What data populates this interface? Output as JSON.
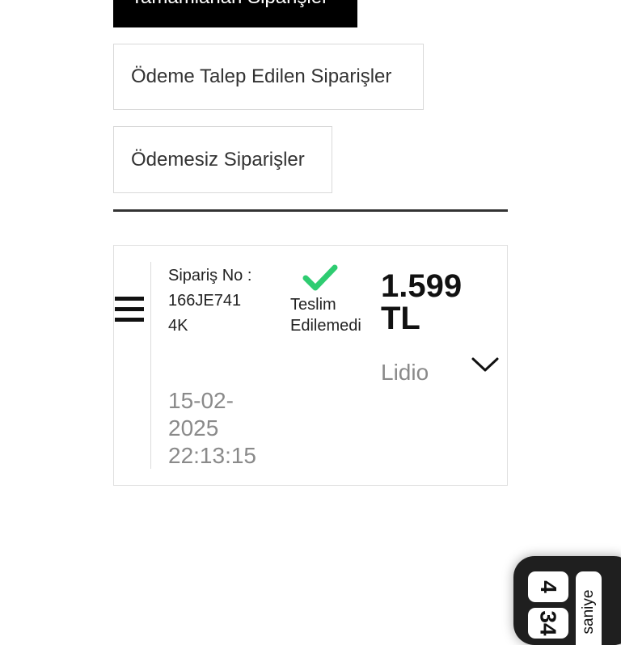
{
  "tabs": {
    "completed": "Tamamlanan Siparişler",
    "payment_requested": "Ödeme Talep Edilen Siparişler",
    "unpaid": "Ödemesiz Siparişler"
  },
  "order": {
    "order_no_label": "Sipariş No :",
    "order_no": "166JE741 4K",
    "date": "15-02-2025 22:13:15",
    "status": "Teslim Edilemedi",
    "price": "1.599 TL",
    "provider": "Lidio"
  },
  "timer": {
    "digits": [
      "4",
      "34"
    ],
    "unit": "saniye"
  },
  "colors": {
    "active_tab": "#000000",
    "check_green": "#2ecc71",
    "muted_text": "#8a8a8a"
  },
  "icons": [
    "menu-icon",
    "checkmark-icon",
    "chevron-down-icon"
  ]
}
